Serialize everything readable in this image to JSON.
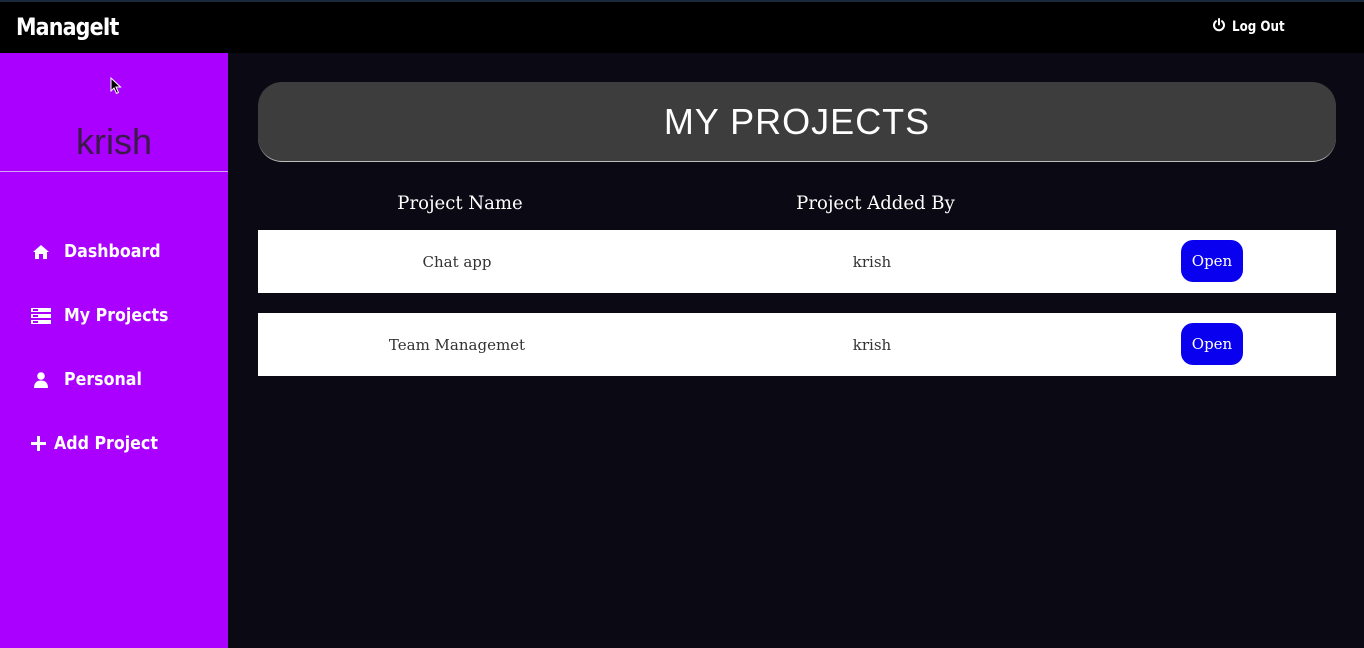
{
  "app": {
    "brand": "ManageIt",
    "logout_label": "Log Out"
  },
  "sidebar": {
    "username": "krish",
    "items": [
      {
        "label": "Dashboard",
        "icon": "home-icon"
      },
      {
        "label": "My Projects",
        "icon": "server-icon"
      },
      {
        "label": "Personal",
        "icon": "user-icon"
      },
      {
        "label": "Add Project",
        "icon": "plus-icon"
      }
    ]
  },
  "main": {
    "title": "MY PROJECTS",
    "columns": [
      "Project Name",
      "Project Added By"
    ],
    "rows": [
      {
        "name": "Chat app",
        "added_by": "krish",
        "action": "Open"
      },
      {
        "name": "Team Managemet",
        "added_by": "krish",
        "action": "Open"
      }
    ]
  },
  "colors": {
    "sidebar": "#aa00ff",
    "topbar": "#000000",
    "background": "#0b0914",
    "header_panel": "#3d3d3d",
    "open_button": "#0a00f0"
  }
}
